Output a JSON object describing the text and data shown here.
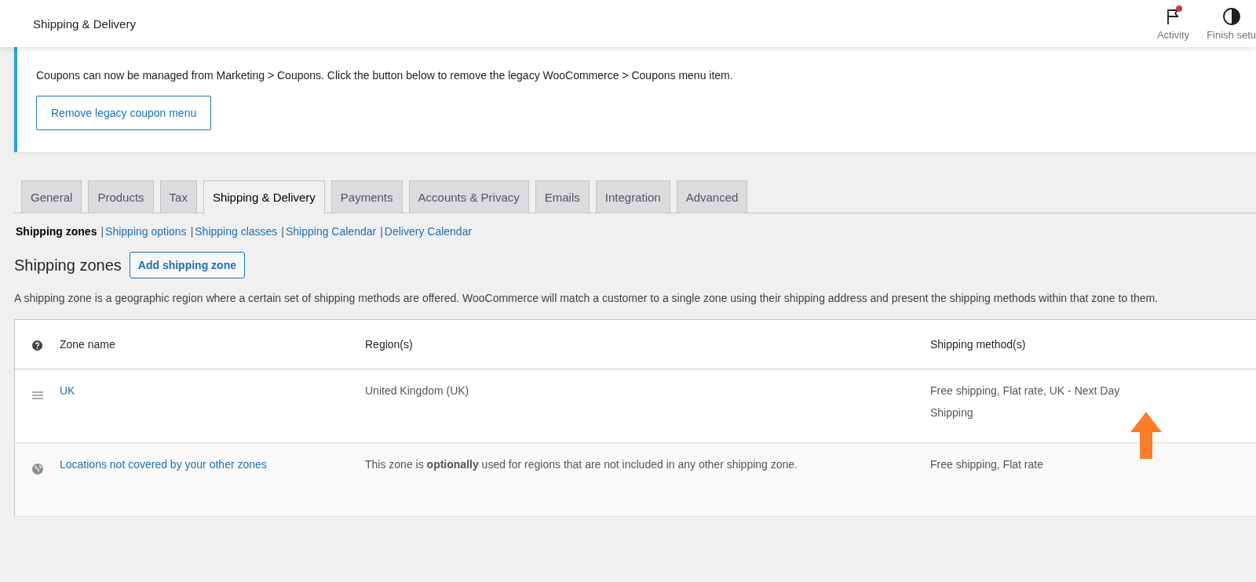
{
  "header": {
    "title": "Shipping & Delivery",
    "actions": [
      {
        "kind": "flag",
        "label": "Activity",
        "badge": true
      },
      {
        "kind": "half-circle",
        "label": "Finish setu"
      }
    ]
  },
  "notice": {
    "text": "Coupons can now be managed from Marketing > Coupons. Click the button below to remove the legacy WooCommerce > Coupons menu item.",
    "button": "Remove legacy coupon menu"
  },
  "tabs": [
    {
      "label": "General",
      "selected": false
    },
    {
      "label": "Products",
      "selected": false
    },
    {
      "label": "Tax",
      "selected": false
    },
    {
      "label": "Shipping & Delivery",
      "selected": true
    },
    {
      "label": "Payments",
      "selected": false
    },
    {
      "label": "Accounts & Privacy",
      "selected": false
    },
    {
      "label": "Emails",
      "selected": false
    },
    {
      "label": "Integration",
      "selected": false
    },
    {
      "label": "Advanced",
      "selected": false
    }
  ],
  "subnav": [
    {
      "label": "Shipping zones",
      "selected": true
    },
    {
      "separator": "|",
      "label": "Shipping options",
      "selected": false
    },
    {
      "separator": "|",
      "label": "Shipping classes",
      "selected": false
    },
    {
      "separator": "|",
      "label": "Shipping Calendar",
      "selected": false
    },
    {
      "separator": "|",
      "label": "Delivery Calendar",
      "selected": false
    }
  ],
  "section": {
    "title": "Shipping zones",
    "button": "Add shipping zone",
    "description": "A shipping zone is a geographic region where a certain set of shipping methods are offered. WooCommerce will match a customer to a single zone using their shipping address and present the shipping methods within that zone to them."
  },
  "table": {
    "columns": [
      "Zone name",
      "Region(s)",
      "Shipping method(s)"
    ],
    "rows": [
      {
        "kind": "zone",
        "name": "UK",
        "region": "United Kingdom (UK)",
        "methods": "Free shipping, Flat rate, UK - Next Day Shipping"
      },
      {
        "kind": "everywhere",
        "name": "Locations not covered by your other zones",
        "region": "This zone is **optionally** used for regions that are not included in any other shipping zone.",
        "methods": "Free shipping, Flat rate"
      }
    ]
  }
}
